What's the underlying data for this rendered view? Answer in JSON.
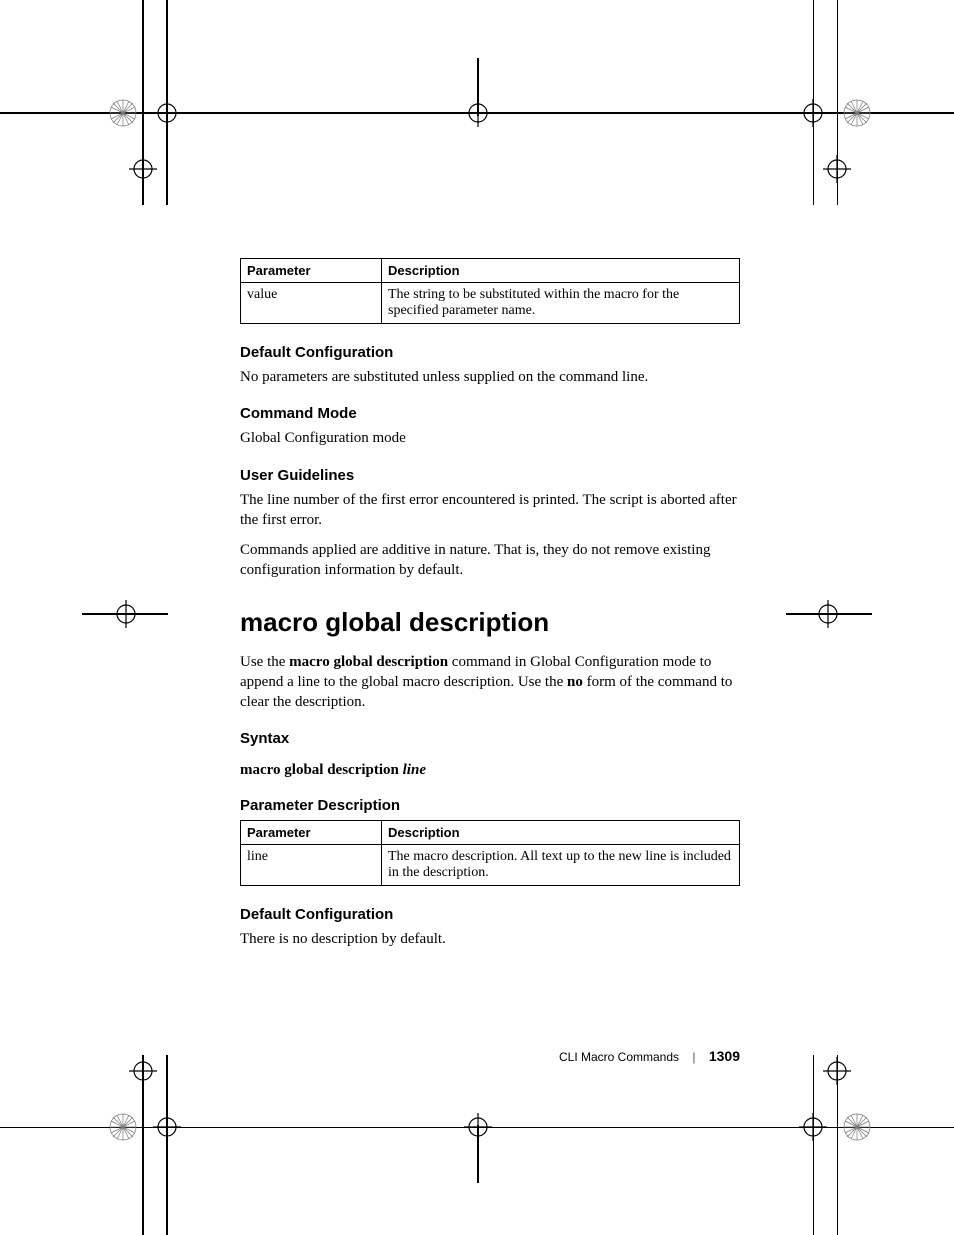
{
  "table1": {
    "headers": [
      "Parameter",
      "Description"
    ],
    "rows": [
      [
        "value",
        "The string to be substituted within the macro for the specified parameter name."
      ]
    ]
  },
  "sections": {
    "default_config_1": {
      "heading": "Default Configuration",
      "text": "No parameters are substituted unless supplied on the command line."
    },
    "command_mode": {
      "heading": "Command Mode",
      "text": "Global Configuration mode"
    },
    "user_guidelines": {
      "heading": "User Guidelines",
      "p1": "The line number of the first error encountered is printed. The script is aborted after the first error.",
      "p2": "Commands applied are additive in nature. That is, they do not remove existing configuration information by default."
    }
  },
  "command": {
    "title": "macro global description",
    "intro_pre": "Use the ",
    "intro_bold1": "macro global description",
    "intro_mid": " command in Global Configuration mode to append a line to the global macro description. Use the ",
    "intro_bold2": "no",
    "intro_post": " form of the command to clear the description.",
    "syntax_heading": "Syntax",
    "syntax_bold": "macro global description ",
    "syntax_italic": "line",
    "param_desc_heading": "Parameter Description"
  },
  "table2": {
    "headers": [
      "Parameter",
      "Description"
    ],
    "rows": [
      [
        "line",
        "The macro description. All text up to the new line is included in the description."
      ]
    ]
  },
  "default_config_2": {
    "heading": "Default Configuration",
    "text": "There is no description by default."
  },
  "footer": {
    "section": "CLI Macro Commands",
    "page": "1309"
  }
}
